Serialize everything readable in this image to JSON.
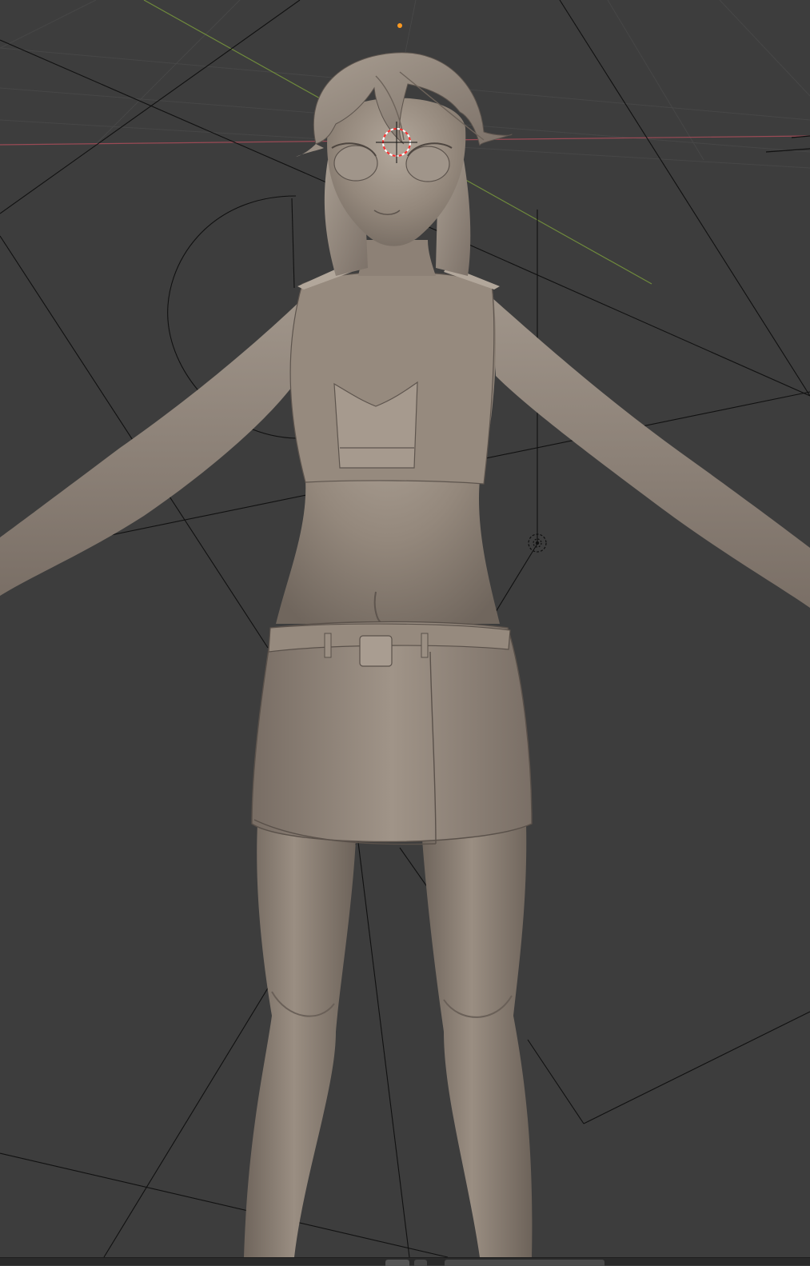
{
  "app": {
    "name": "3D viewport",
    "view": "perspective"
  },
  "viewport": {
    "background_color": "#3d3d3d",
    "grid_color": "#474747",
    "x_axis_color": "#9a4a55",
    "y_axis_color": "#6f8a3c",
    "object_color": "#8f8378",
    "object_shadow_color": "#6c625a",
    "object_highlight_color": "#bdb2a6",
    "wire_color": "#111111",
    "cursor_color": "#ff3030",
    "origin_color": "#ff9a20"
  },
  "scene": {
    "objects": [
      {
        "name": "character-body",
        "icon": "mesh-icon"
      },
      {
        "name": "camera",
        "icon": "camera-icon"
      },
      {
        "name": "light",
        "icon": "light-icon"
      }
    ],
    "cursor_icon": "3d-cursor-icon",
    "origin_icon": "object-origin-icon"
  }
}
